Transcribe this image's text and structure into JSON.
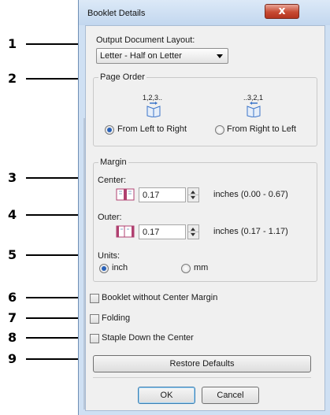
{
  "callouts": [
    "1",
    "2",
    "3",
    "4",
    "5",
    "6",
    "7",
    "8",
    "9"
  ],
  "window": {
    "title": "Booklet Details",
    "close_glyph": "x"
  },
  "output_layout": {
    "label": "Output Document Layout:",
    "value": "Letter - Half on Letter"
  },
  "page_order": {
    "legend": "Page Order",
    "ltr_caption": "1,2,3..",
    "rtl_caption": "..3,2,1",
    "ltr_label": "From Left to Right",
    "rtl_label": "From Right to Left",
    "selected": "ltr",
    "icon": "book-page-icon"
  },
  "margin": {
    "legend": "Margin",
    "center_label": "Center:",
    "center_value": "0.17",
    "center_range": "inches (0.00 - 0.67)",
    "outer_label": "Outer:",
    "outer_value": "0.17",
    "outer_range": "inches (0.17 - 1.17)",
    "units_label": "Units:",
    "unit_inch": "inch",
    "unit_mm": "mm",
    "selected_unit": "inch"
  },
  "options": {
    "no_center_margin": "Booklet without Center Margin",
    "folding": "Folding",
    "staple_center": "Staple Down the Center"
  },
  "buttons": {
    "restore_defaults": "Restore Defaults",
    "ok": "OK",
    "cancel": "Cancel"
  },
  "colors": {
    "titlebar": "#c2d7ef",
    "close_button": "#c74a32",
    "radio_dot": "#2a62b8",
    "icon_blue": "#3b74c9",
    "margin_icon": "#b04070"
  }
}
